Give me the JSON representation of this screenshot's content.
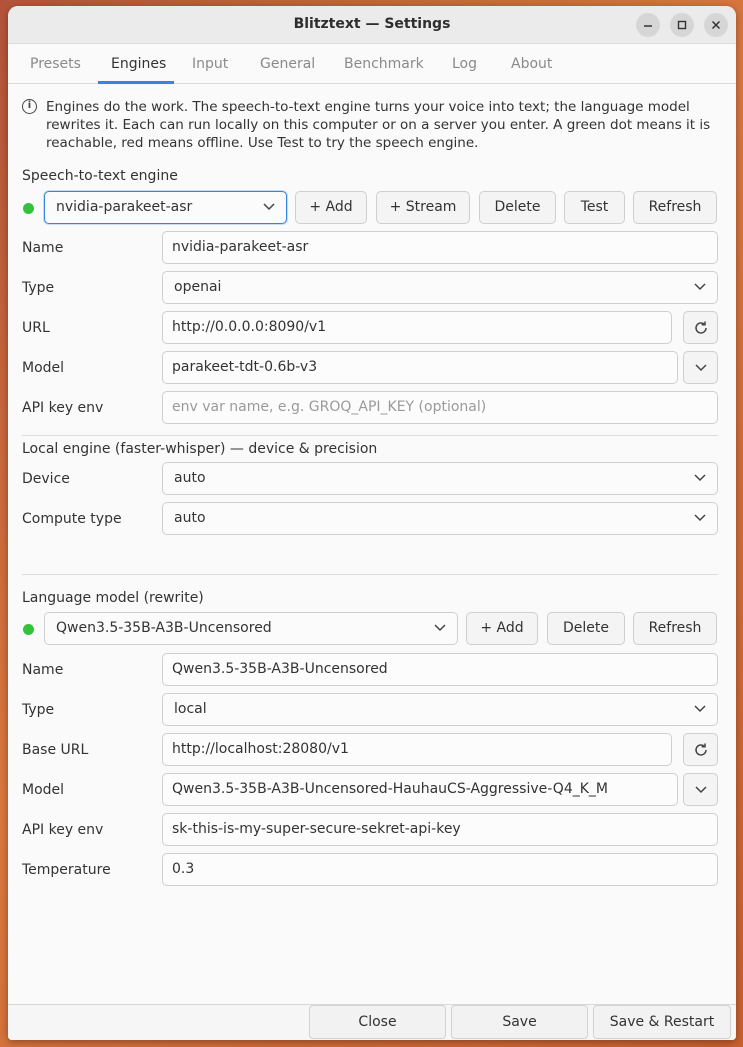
{
  "window": {
    "title": "Blitztext — Settings",
    "controls": [
      "minimize-icon",
      "maximize-icon",
      "close-icon"
    ]
  },
  "tabs": [
    {
      "label": "Presets",
      "active": false
    },
    {
      "label": "Engines",
      "active": true
    },
    {
      "label": "Input",
      "active": false
    },
    {
      "label": "General",
      "active": false
    },
    {
      "label": "Benchmark",
      "active": false
    },
    {
      "label": "Log",
      "active": false
    },
    {
      "label": "About",
      "active": false
    }
  ],
  "info": {
    "icon": "info-icon",
    "text": "Engines do the work. The speech-to-text engine turns your voice into text; the language model rewrites it. Each can run locally on this computer or on a server you enter. A green dot means it is reachable, red means offline. Use Test to try the speech engine."
  },
  "stt": {
    "heading": "Speech-to-text engine",
    "status_color": "#33c23b",
    "selected_engine": "nvidia-parakeet-asr",
    "buttons": {
      "add": "+ Add",
      "stream": "+ Stream",
      "delete": "Delete",
      "test": "Test",
      "refresh": "Refresh"
    },
    "fields": {
      "name_label": "Name",
      "name_value": "nvidia-parakeet-asr",
      "type_label": "Type",
      "type_value": "openai",
      "url_label": "URL",
      "url_value": "http://0.0.0.0:8090/v1",
      "model_label": "Model",
      "model_value": "parakeet-tdt-0.6b-v3",
      "apikey_label": "API key env",
      "apikey_placeholder": "env var name, e.g. GROQ_API_KEY  (optional)"
    }
  },
  "local_engine": {
    "heading": "Local engine (faster-whisper) — device & precision",
    "device_label": "Device",
    "device_value": "auto",
    "compute_label": "Compute type",
    "compute_value": "auto"
  },
  "llm": {
    "heading": "Language model (rewrite)",
    "status_color": "#33c23b",
    "selected_model": "Qwen3.5-35B-A3B-Uncensored",
    "buttons": {
      "add": "+ Add",
      "delete": "Delete",
      "refresh": "Refresh"
    },
    "fields": {
      "name_label": "Name",
      "name_value": "Qwen3.5-35B-A3B-Uncensored",
      "type_label": "Type",
      "type_value": "local",
      "baseurl_label": "Base URL",
      "baseurl_value": "http://localhost:28080/v1",
      "model_label": "Model",
      "model_value": "Qwen3.5-35B-A3B-Uncensored-HauhauCS-Aggressive-Q4_K_M",
      "apikey_label": "API key env",
      "apikey_value": "sk-this-is-my-super-secure-sekret-api-key",
      "temperature_label": "Temperature",
      "temperature_value": "0.3"
    }
  },
  "footer": {
    "close": "Close",
    "save": "Save",
    "save_restart": "Save & Restart"
  }
}
